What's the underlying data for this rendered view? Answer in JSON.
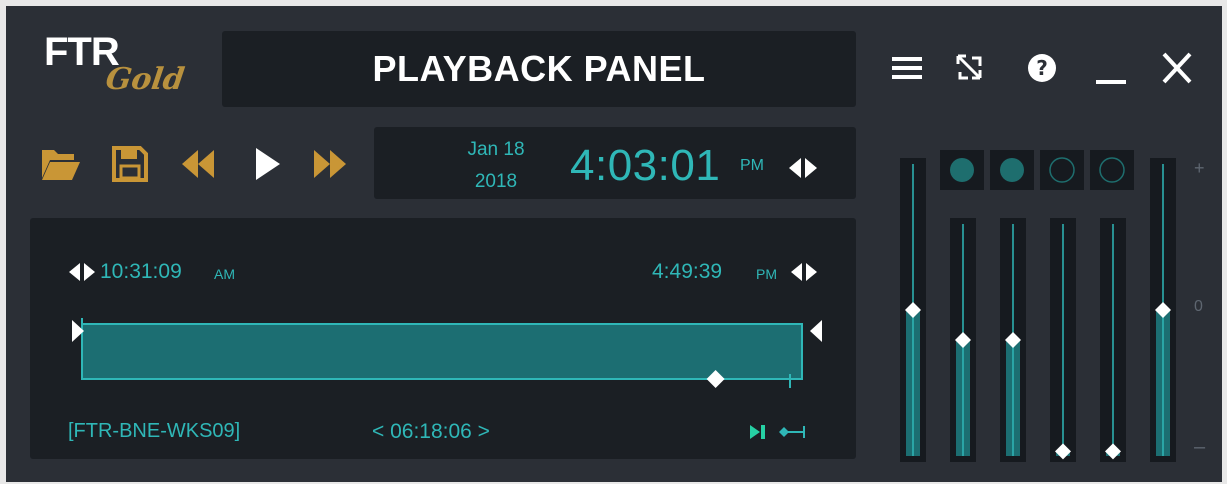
{
  "app": {
    "logo": {
      "main": "FTR",
      "script": "Gold"
    },
    "title": "PLAYBACK PANEL"
  },
  "window_controls": [
    {
      "icon": "hamburger-menu-icon"
    },
    {
      "icon": "resize-window-icon"
    },
    {
      "icon": "help-icon"
    },
    {
      "icon": "minimize-icon"
    },
    {
      "icon": "close-icon"
    }
  ],
  "transport": [
    {
      "icon": "open-folder-icon"
    },
    {
      "icon": "save-icon"
    },
    {
      "icon": "rewind-icon"
    },
    {
      "icon": "play-icon"
    },
    {
      "icon": "fast-forward-icon"
    }
  ],
  "clock": {
    "date_line1": "Jan 18",
    "date_line2": "2018",
    "time": "4:03:01",
    "ampm": "PM"
  },
  "timeline": {
    "start_time": "10:31:09",
    "start_ampm": "AM",
    "end_time": "4:49:39",
    "end_ampm": "PM",
    "playhead_fraction": 0.88,
    "machine": "[FTR-BNE-WKS09]",
    "duration": "< 06:18:06 >",
    "icons": [
      "jump-to-end-icon",
      "return-to-marker-icon"
    ]
  },
  "mixer": {
    "scale_top": "+",
    "scale_mid": "0",
    "scale_bottom": "–",
    "channel_buttons": [
      {
        "state": "on"
      },
      {
        "state": "on"
      },
      {
        "state": "off"
      },
      {
        "state": "off"
      }
    ],
    "master_left_level": 0.5,
    "master_right_level": 0.5,
    "channel_levels": [
      0.5,
      0.5,
      0.02,
      0.02
    ]
  },
  "colors": {
    "teal": "#2fb7b7",
    "teal_fill": "#1c6e72",
    "gold": "#c99636",
    "panel": "#1b1f24",
    "background": "#2b2f36"
  }
}
